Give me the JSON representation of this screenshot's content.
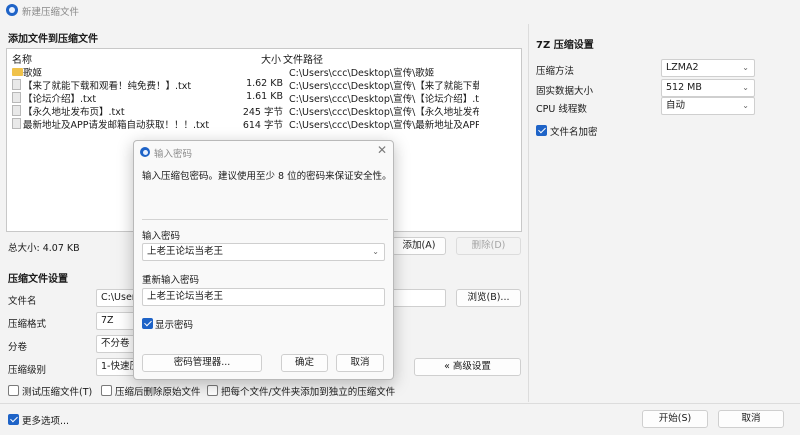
{
  "window": {
    "title": "新建压缩文件"
  },
  "files_section": {
    "title": "添加文件到压缩文件",
    "columns": {
      "name": "名称",
      "size": "大小",
      "path": "文件路径"
    },
    "rows": [
      {
        "name": "歌姬",
        "size": "",
        "path": "C:\\Users\\ccc\\Desktop\\宣传\\歌姬",
        "type": "folder"
      },
      {
        "name": "【来了就能下载和观看！纯免费！】.txt",
        "size": "1.62 KB",
        "path": "C:\\Users\\ccc\\Desktop\\宣传\\【来了就能下载和...",
        "type": "file"
      },
      {
        "name": "【论坛介绍】.txt",
        "size": "1.61 KB",
        "path": "C:\\Users\\ccc\\Desktop\\宣传\\【论坛介绍】.txt",
        "type": "file"
      },
      {
        "name": "【永久地址发布页】.txt",
        "size": "245 字节",
        "path": "C:\\Users\\ccc\\Desktop\\宣传\\【永久地址发布页...",
        "type": "file"
      },
      {
        "name": "最新地址及APP请发邮箱自动获取！！！.txt",
        "size": "614 字节",
        "path": "C:\\Users\\ccc\\Desktop\\宣传\\最新地址及APP请...",
        "type": "file"
      }
    ],
    "total_size": "总大小: 4.07 KB",
    "add_button": "添加(A)",
    "delete_button": "删除(D)"
  },
  "archive_settings": {
    "title": "压缩文件设置",
    "filename_label": "文件名",
    "filename_value": "C:\\Users\\",
    "browse_button": "浏览(B)...",
    "format_label": "压缩格式",
    "format_value": "7Z",
    "split_label": "分卷",
    "split_value": "不分卷",
    "level_label": "压缩级别",
    "level_value": "1-快速压",
    "advanced_button": "« 高级设置",
    "test_checkbox": "测试压缩文件(T)",
    "delete_after_checkbox": "压缩后删除原始文件",
    "separate_checkbox": "把每个文件/文件夹添加到独立的压缩文件"
  },
  "seven_z_settings": {
    "title": "7Z 压缩设置",
    "method_label": "压缩方法",
    "method_value": "LZMA2",
    "dict_label": "固实数据大小",
    "dict_value": "512 MB",
    "threads_label": "CPU 线程数",
    "threads_value": "自动",
    "encrypt_names_label": "文件名加密"
  },
  "bottom": {
    "more_options": "更多选项...",
    "start_button": "开始(S)",
    "cancel_button": "取消"
  },
  "password_dialog": {
    "title": "输入密码",
    "hint": "输入压缩包密码。建议使用至少 8 位的密码来保证安全性。",
    "password_label": "输入密码",
    "password_value": "上老王论坛当老王",
    "reenter_label": "重新输入密码",
    "reenter_value": "上老王论坛当老王",
    "show_password": "显示密码",
    "manager_button": "密码管理器...",
    "ok_button": "确定",
    "cancel_button": "取消"
  }
}
